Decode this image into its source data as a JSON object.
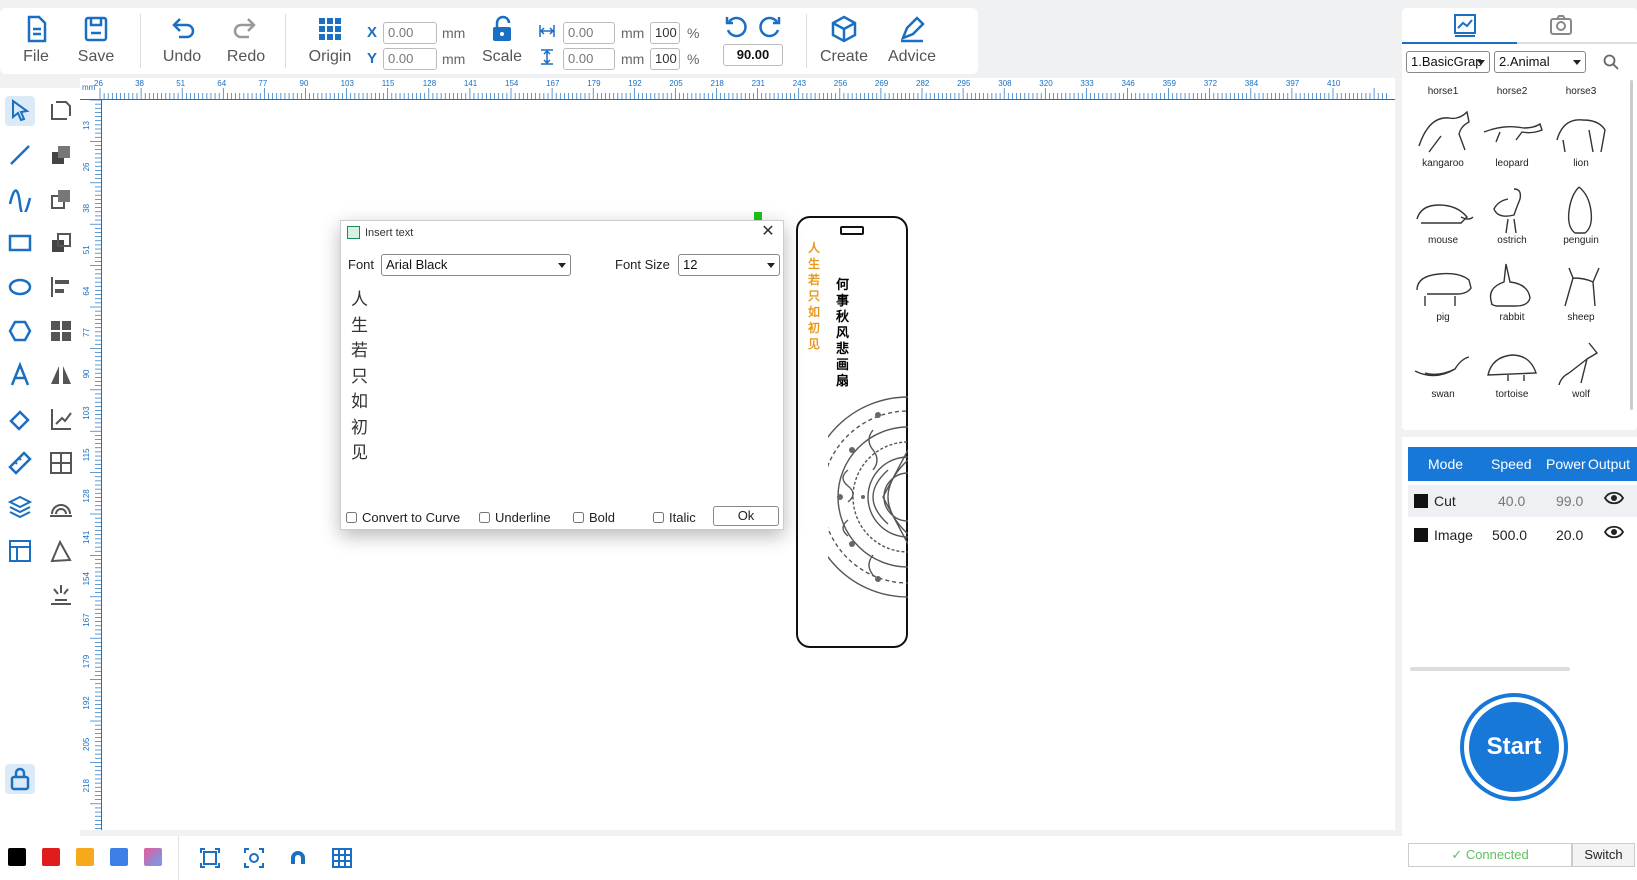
{
  "toolbar": {
    "file": "File",
    "save": "Save",
    "undo": "Undo",
    "redo": "Redo",
    "origin": "Origin",
    "scale": "Scale",
    "create": "Create",
    "advice": "Advice",
    "x_label": "X",
    "y_label": "Y",
    "x_value": "0.00",
    "y_value": "0.00",
    "w_value": "0.00",
    "h_value": "0.00",
    "w_pct": "100",
    "h_pct": "100",
    "unit": "mm",
    "pct": "%",
    "rotation": "90.00"
  },
  "ruler": {
    "unit": "mm",
    "top": [
      "26",
      "38",
      "51",
      "64",
      "77",
      "90",
      "103",
      "115",
      "128",
      "141",
      "154",
      "167",
      "179",
      "192",
      "205",
      "218",
      "231",
      "243",
      "256",
      "269",
      "282",
      "295",
      "308",
      "320",
      "333",
      "346",
      "359",
      "372",
      "384",
      "397",
      "410"
    ],
    "left": [
      "13",
      "26",
      "38",
      "51",
      "64",
      "77",
      "90",
      "103",
      "115",
      "128",
      "141",
      "154",
      "167",
      "179",
      "192",
      "205",
      "218"
    ]
  },
  "library": {
    "category": "1.BasicGrap",
    "subcategory": "2.Animal",
    "top_labels": [
      "horse1",
      "horse2",
      "horse3"
    ],
    "shapes": [
      "kangaroo",
      "leopard",
      "lion",
      "mouse",
      "ostrich",
      "penguin",
      "pig",
      "rabbit",
      "sheep",
      "swan",
      "tortoise",
      "wolf"
    ]
  },
  "layers": {
    "headers": {
      "mode": "Mode",
      "speed": "Speed",
      "power": "Power",
      "output": "Output"
    },
    "rows": [
      {
        "mode": "Cut",
        "speed": "40.0",
        "power": "99.0",
        "color": "#111111"
      },
      {
        "mode": "Image",
        "speed": "500.0",
        "power": "20.0",
        "color": "#111111"
      }
    ]
  },
  "start": {
    "label": "Start",
    "status": "Connected",
    "switch": "Switch"
  },
  "dialog": {
    "title": "Insert text",
    "font_label": "Font",
    "font_value": "Arial Black",
    "size_label": "Font Size",
    "size_value": "12",
    "text_lines": [
      "人",
      "生",
      "若",
      "只",
      "如",
      "初",
      "见"
    ],
    "convert": "Convert to Curve",
    "underline": "Underline",
    "bold": "Bold",
    "italic": "Italic",
    "ok": "Ok"
  },
  "artwork": {
    "orange_text": [
      "人",
      "生",
      "若",
      "只",
      "如",
      "初",
      "见"
    ],
    "black_text": [
      "何",
      "事",
      "秋",
      "风",
      "悲",
      "画",
      "扇"
    ]
  },
  "colors": {
    "accent": "#1878d8",
    "orange": "#e89a1f",
    "palette": [
      "#000000",
      "#e01c1c",
      "#f7a81b",
      "#3c7fe8",
      "#e85a9a"
    ]
  }
}
